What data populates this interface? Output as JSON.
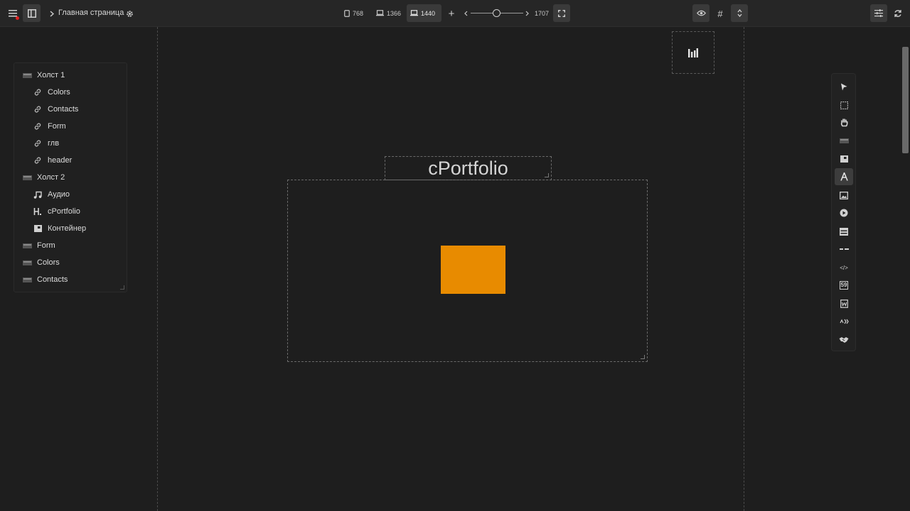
{
  "header": {
    "page_title": "Главная страница",
    "breakpoints": [
      {
        "label": "768",
        "device": "tablet"
      },
      {
        "label": "1366",
        "device": "laptop"
      },
      {
        "label": "1440",
        "device": "laptop",
        "active": true
      }
    ],
    "add_breakpoint": "+",
    "zoom_max": "1707",
    "zoom_level": 0.5,
    "grid_symbol": "#"
  },
  "layers": [
    {
      "label": "Холст 1",
      "icon": "canvas-icon",
      "level": 0
    },
    {
      "label": "Colors",
      "icon": "link-icon",
      "level": 1
    },
    {
      "label": "Contacts",
      "icon": "link-icon",
      "level": 1
    },
    {
      "label": "Form",
      "icon": "link-icon",
      "level": 1
    },
    {
      "label": "глв",
      "icon": "link-icon",
      "level": 1
    },
    {
      "label": "header",
      "icon": "link-icon",
      "level": 1
    },
    {
      "label": "Холст 2",
      "icon": "canvas-icon",
      "level": 0
    },
    {
      "label": "Аудио",
      "icon": "music-icon",
      "level": 1
    },
    {
      "label": "cPortfolio",
      "icon": "heading-icon",
      "level": 1
    },
    {
      "label": "Контейнер",
      "icon": "container-icon",
      "level": 1
    },
    {
      "label": "Form",
      "icon": "canvas-icon",
      "level": 0
    },
    {
      "label": "Colors",
      "icon": "canvas-icon",
      "level": 0
    },
    {
      "label": "Contacts",
      "icon": "canvas-icon",
      "level": 0
    }
  ],
  "stage": {
    "heading_text": "cPortfolio",
    "rect_color": "#e88b00"
  },
  "tools": [
    {
      "name": "select-tool",
      "icon": "cursor-icon"
    },
    {
      "name": "marquee-tool",
      "icon": "dashed-rect-icon"
    },
    {
      "name": "hand-tool",
      "icon": "hand-icon"
    },
    {
      "name": "canvas-tool",
      "icon": "canvas-icon"
    },
    {
      "name": "container-tool",
      "icon": "container-icon"
    },
    {
      "name": "text-tool",
      "icon": "text-a-icon",
      "active": true
    },
    {
      "name": "image-tool",
      "icon": "image-icon"
    },
    {
      "name": "video-tool",
      "icon": "play-icon"
    },
    {
      "name": "form-tool",
      "icon": "form-icon"
    },
    {
      "name": "divider-tool",
      "icon": "divider-icon"
    },
    {
      "name": "code-tool",
      "icon": "code-icon"
    },
    {
      "name": "counter-tool",
      "icon": "counter-icon"
    },
    {
      "name": "document-tool",
      "icon": "document-icon"
    },
    {
      "name": "link-tool",
      "icon": "link-arrows-icon"
    },
    {
      "name": "handshake-tool",
      "icon": "handshake-icon"
    }
  ],
  "tool_labels": {
    "code": "</>",
    "counter": "59"
  }
}
